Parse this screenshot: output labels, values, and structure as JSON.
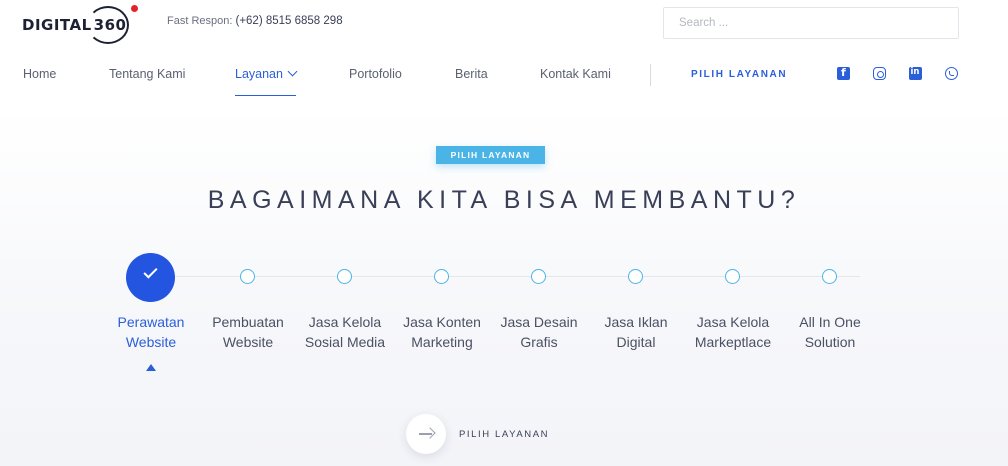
{
  "header": {
    "logo": "DIGITAL 360",
    "fast_label": "Fast Respon:",
    "fast_phone": "(+62) 8515 6858 298",
    "search_placeholder": "Search ..."
  },
  "nav": {
    "items": [
      {
        "label": "Home"
      },
      {
        "label": "Tentang Kami"
      },
      {
        "label": "Layanan",
        "active": true
      },
      {
        "label": "Portofolio"
      },
      {
        "label": "Berita"
      },
      {
        "label": "Kontak Kami"
      }
    ],
    "cta": "PILIH LAYANAN",
    "social_icons": [
      "facebook-icon",
      "instagram-icon",
      "linkedin-icon",
      "whatsapp-icon"
    ]
  },
  "hero": {
    "badge": "PILIH LAYANAN",
    "headline": "BAGAIMANA KITA BISA MEMBANTU?",
    "steps": [
      {
        "line1": "Perawatan",
        "line2": "Website",
        "active": true
      },
      {
        "line1": "Pembuatan",
        "line2": "Website"
      },
      {
        "line1": "Jasa Kelola",
        "line2": "Sosial Media"
      },
      {
        "line1": "Jasa Konten",
        "line2": "Marketing"
      },
      {
        "line1": "Jasa Desain",
        "line2": "Grafis"
      },
      {
        "line1": "Jasa Iklan",
        "line2": "Digital"
      },
      {
        "line1": "Jasa Kelola",
        "line2": "Markeptlace"
      },
      {
        "line1": "All In One",
        "line2": "Solution"
      }
    ],
    "bottom_cta": "PILIH LAYANAN"
  },
  "colors": {
    "accent": "#2b5fd9",
    "active_step": "#2355e0",
    "badge": "#4bb4e6",
    "text": "#3a3f58",
    "logo_dot": "#e4222a"
  }
}
